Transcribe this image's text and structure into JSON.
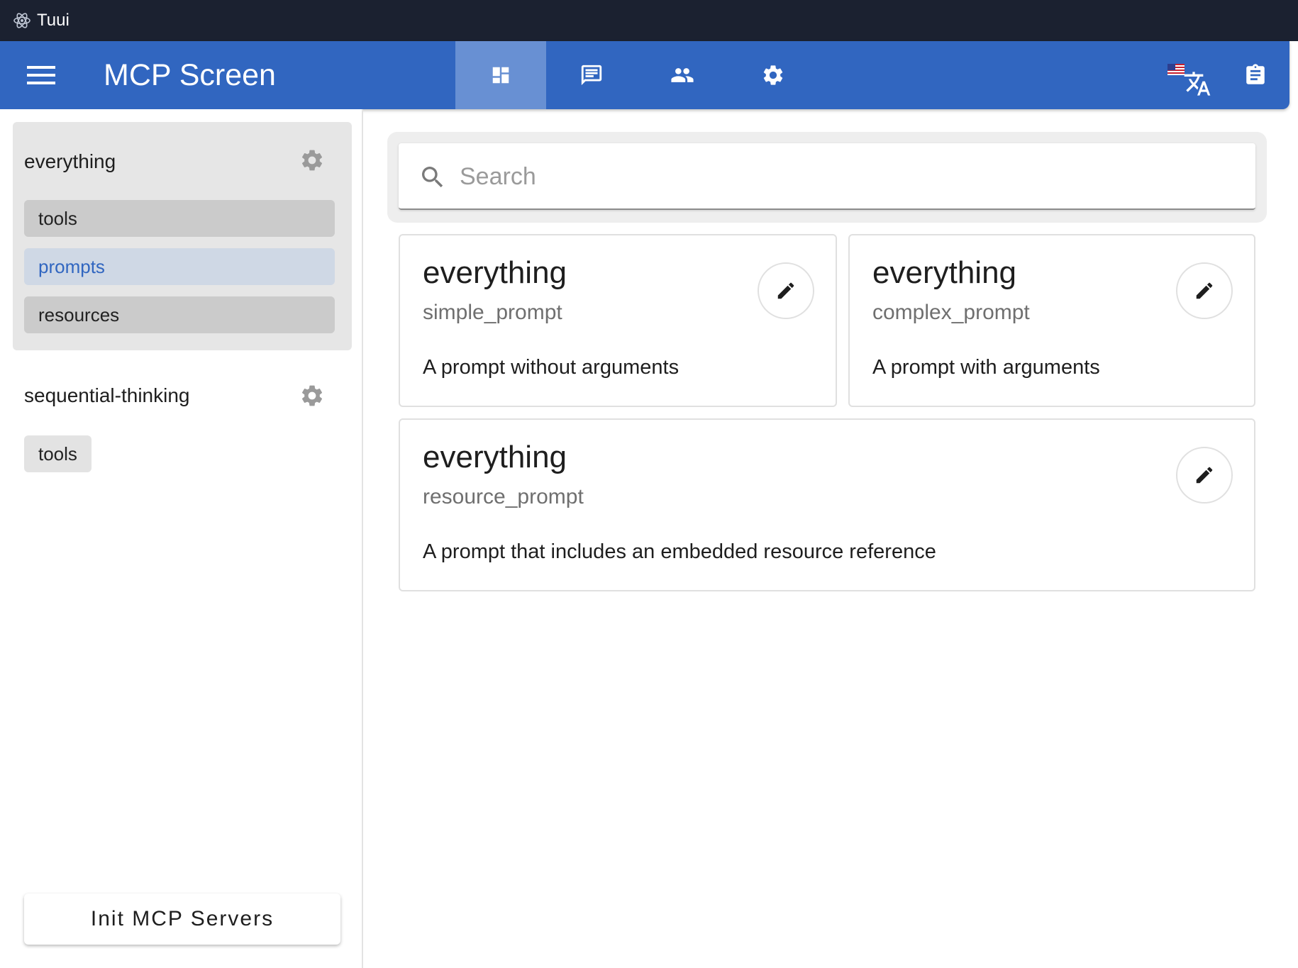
{
  "window": {
    "title": "Tuui"
  },
  "appbar": {
    "title": "MCP Screen",
    "nav": [
      {
        "icon": "dashboard-icon",
        "active": true
      },
      {
        "icon": "chat-icon",
        "active": false
      },
      {
        "icon": "people-icon",
        "active": false
      },
      {
        "icon": "settings-icon",
        "active": false
      }
    ],
    "accent": "#3166c0",
    "active_tab_color": "#6890d3"
  },
  "sidebar": {
    "servers": [
      {
        "name": "everything",
        "items": [
          "tools",
          "prompts",
          "resources"
        ],
        "active_item": "prompts"
      },
      {
        "name": "sequential-thinking",
        "items": [
          "tools"
        ]
      }
    ],
    "init_button": "Init MCP Servers"
  },
  "search": {
    "placeholder": "Search",
    "value": ""
  },
  "prompts": [
    {
      "server": "everything",
      "name": "simple_prompt",
      "description": "A prompt without arguments"
    },
    {
      "server": "everything",
      "name": "complex_prompt",
      "description": "A prompt with arguments"
    },
    {
      "server": "everything",
      "name": "resource_prompt",
      "description": "A prompt that includes an embedded resource reference"
    }
  ]
}
